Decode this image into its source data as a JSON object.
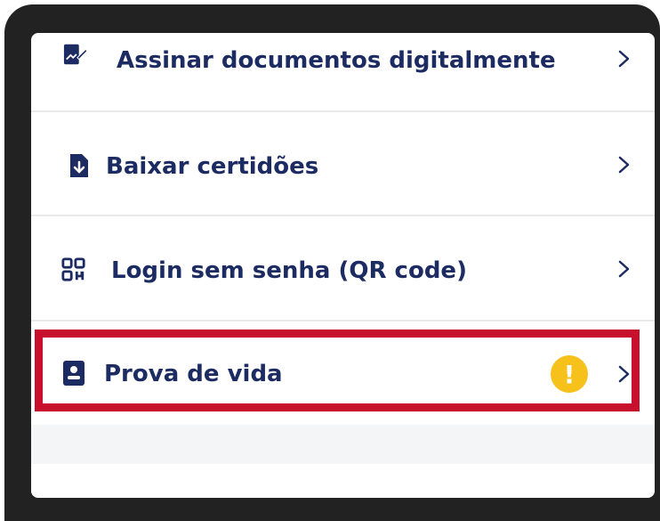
{
  "menu": {
    "items": [
      {
        "label": "Assinar documentos digitalmente",
        "icon": "signature-icon"
      },
      {
        "label": "Baixar certidões",
        "icon": "download-document-icon"
      },
      {
        "label": "Login sem senha (QR code)",
        "icon": "qr-code-icon"
      },
      {
        "label": "Prova de vida",
        "icon": "id-card-icon",
        "badge": "!"
      }
    ]
  },
  "colors": {
    "label": "#1d2b63",
    "highlight": "#c8102e",
    "warning": "#f6c11b"
  }
}
